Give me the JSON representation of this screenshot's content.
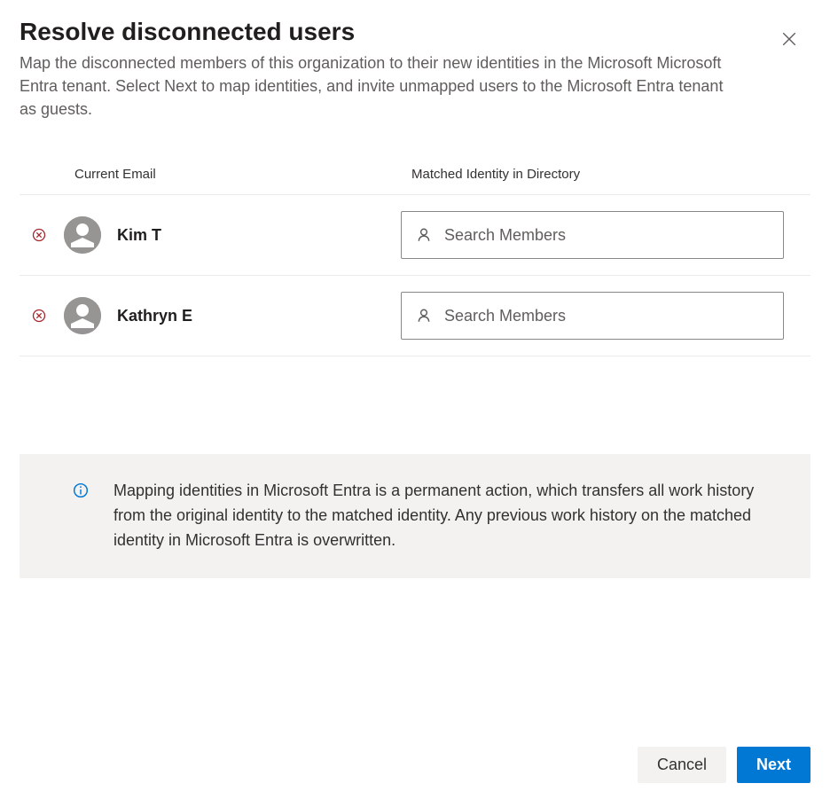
{
  "header": {
    "title": "Resolve disconnected users",
    "subtitle": "Map the disconnected members of this organization to their new identities in the Microsoft Microsoft Entra tenant. Select Next to map identities, and invite unmapped users to the Microsoft Entra tenant as guests."
  },
  "columns": {
    "email": "Current Email",
    "identity": "Matched Identity in Directory"
  },
  "rows": [
    {
      "name": "Kim T",
      "search_placeholder": "Search Members"
    },
    {
      "name": "Kathryn E",
      "search_placeholder": "Search Members"
    }
  ],
  "info": {
    "text": "Mapping identities in Microsoft Entra is a permanent action, which transfers all work history from the original identity to the matched identity. Any previous work history on the matched identity in Microsoft Entra is overwritten."
  },
  "footer": {
    "cancel": "Cancel",
    "next": "Next"
  }
}
